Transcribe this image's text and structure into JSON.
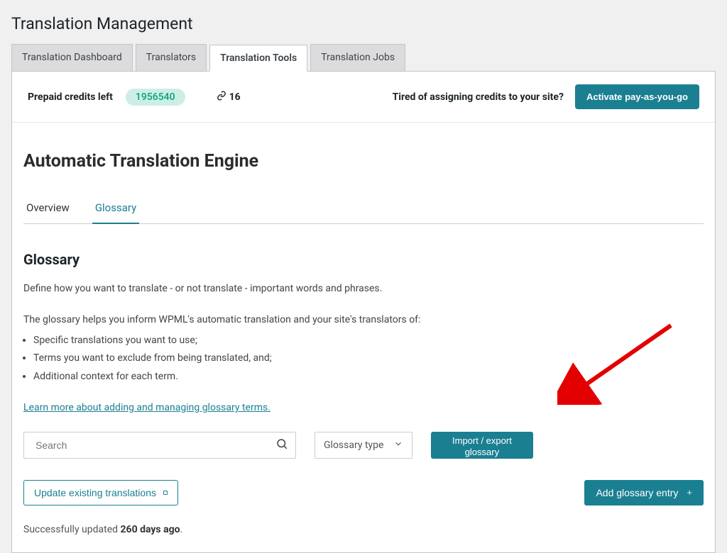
{
  "page_title": "Translation Management",
  "tabs": [
    {
      "label": "Translation Dashboard"
    },
    {
      "label": "Translators"
    },
    {
      "label": "Translation Tools"
    },
    {
      "label": "Translation Jobs"
    }
  ],
  "credits": {
    "label": "Prepaid credits left",
    "value": "1956540",
    "link_count": "16",
    "question": "Tired of assigning credits to your site?",
    "activate_btn": "Activate pay-as-you-go"
  },
  "section_title": "Automatic Translation Engine",
  "subtabs": [
    {
      "label": "Overview"
    },
    {
      "label": "Glossary"
    }
  ],
  "glossary": {
    "heading": "Glossary",
    "intro": "Define how you want to translate - or not translate - important words and phrases.",
    "help_intro": "The glossary helps you inform WPML's automatic translation and your site's translators of:",
    "bullets": [
      "Specific translations you want to use;",
      "Terms you want to exclude from being translated, and;",
      "Additional context for each term."
    ],
    "learn_more": "Learn more about adding and managing glossary terms.",
    "search_placeholder": "Search",
    "type_label": "Glossary type",
    "import_btn_line1": "Import / export",
    "import_btn_line2": "glossary",
    "update_btn": "Update existing translations",
    "add_btn": "Add glossary entry",
    "updated_prefix": "Successfully updated ",
    "updated_value": "260 days ago",
    "updated_suffix": "."
  }
}
